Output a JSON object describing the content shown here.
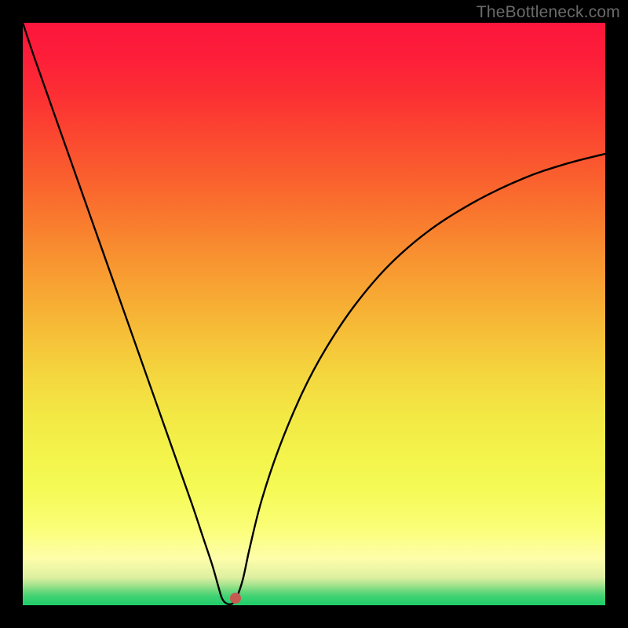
{
  "attribution": "TheBottleneck.com",
  "chart_data": {
    "type": "line",
    "title": "",
    "xlabel": "",
    "ylabel": "",
    "xlim": [
      0,
      100
    ],
    "ylim": [
      0,
      100
    ],
    "gradient_stops": [
      {
        "offset": 0.0,
        "color": "#fd163c"
      },
      {
        "offset": 0.06,
        "color": "#fd1e39"
      },
      {
        "offset": 0.13,
        "color": "#fc3133"
      },
      {
        "offset": 0.2,
        "color": "#fb4930"
      },
      {
        "offset": 0.27,
        "color": "#fa612e"
      },
      {
        "offset": 0.34,
        "color": "#f97b2e"
      },
      {
        "offset": 0.4,
        "color": "#f89130"
      },
      {
        "offset": 0.47,
        "color": "#f7a933"
      },
      {
        "offset": 0.54,
        "color": "#f6c138"
      },
      {
        "offset": 0.61,
        "color": "#f4d83f"
      },
      {
        "offset": 0.67,
        "color": "#f3e744"
      },
      {
        "offset": 0.74,
        "color": "#f3f34b"
      },
      {
        "offset": 0.8,
        "color": "#f5fa55"
      },
      {
        "offset": 0.87,
        "color": "#fbfe78"
      },
      {
        "offset": 0.92,
        "color": "#fefeaa"
      },
      {
        "offset": 0.952,
        "color": "#def0a1"
      },
      {
        "offset": 0.965,
        "color": "#a7e38e"
      },
      {
        "offset": 0.975,
        "color": "#6fd97e"
      },
      {
        "offset": 0.985,
        "color": "#3fd273"
      },
      {
        "offset": 1.0,
        "color": "#1ecd69"
      }
    ],
    "series": [
      {
        "name": "bottleneck-curve",
        "x": [
          0.0,
          2.0,
          5.0,
          8.0,
          11.0,
          14.0,
          17.0,
          20.0,
          23.0,
          26.0,
          29.0,
          31.0,
          32.5,
          33.5,
          34.2,
          35.0,
          36.0,
          36.8,
          37.8,
          39.0,
          41.0,
          44.0,
          48.0,
          52.0,
          57.0,
          63.0,
          70.0,
          78.0,
          86.0,
          93.0,
          100.0
        ],
        "y": [
          100.0,
          94.0,
          85.5,
          77.0,
          68.5,
          60.0,
          51.5,
          43.0,
          34.5,
          26.0,
          17.5,
          11.5,
          7.0,
          3.5,
          1.2,
          0.3,
          0.3,
          1.5,
          4.5,
          10.0,
          18.0,
          27.0,
          36.5,
          44.0,
          51.5,
          58.5,
          64.5,
          69.5,
          73.3,
          75.7,
          77.5
        ]
      }
    ],
    "marker": {
      "x": 36.5,
      "y": 1.2,
      "color": "#c65a53"
    }
  }
}
